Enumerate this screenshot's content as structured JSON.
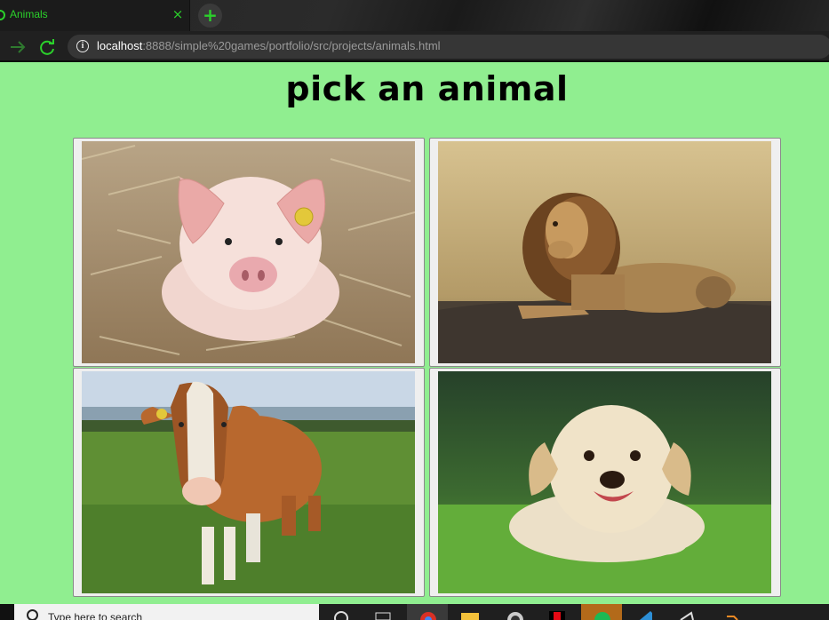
{
  "browser": {
    "tab_title": "Animals",
    "close_glyph": "×",
    "new_tab_glyph": "+",
    "url_host": "localhost",
    "url_rest": ":8888/simple%20games/portfolio/src/projects/animals.html"
  },
  "page": {
    "title": "pick an animal",
    "background": "#90ee90",
    "choices": [
      {
        "animal": "pig",
        "icon": "pig-image"
      },
      {
        "animal": "lion",
        "icon": "lion-image"
      },
      {
        "animal": "cow",
        "icon": "cow-image"
      },
      {
        "animal": "dog",
        "icon": "dog-image"
      }
    ]
  },
  "taskbar": {
    "search_placeholder": "Type here to search",
    "apps": [
      "cortana-icon",
      "task-view-icon",
      "chrome-icon",
      "file-explorer-icon",
      "obs-icon",
      "netflix-icon",
      "spotify-icon",
      "vscode-icon",
      "app-icon",
      "app-icon"
    ]
  },
  "colors": {
    "accent_green": "#2bd12b",
    "chrome_dark": "#202020"
  }
}
